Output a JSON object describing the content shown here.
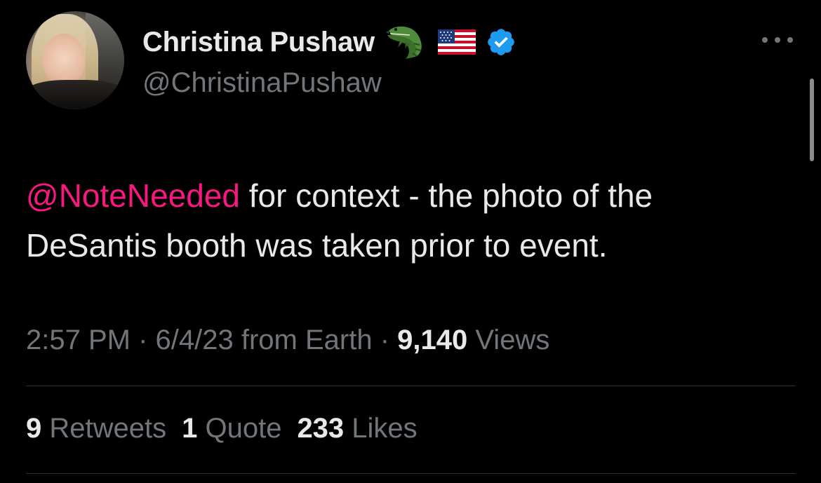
{
  "author": {
    "display_name": "Christina Pushaw",
    "handle": "@ChristinaPushaw",
    "name_badges": [
      "alligator-emoji",
      "us-flag-emoji",
      "verified-badge"
    ]
  },
  "tweet": {
    "mention": "@NoteNeeded",
    "line1_rest": " for context - the photo of the",
    "line2": "DeSantis booth was taken prior to event."
  },
  "meta": {
    "time": "2:57 PM",
    "sep1": " · ",
    "date": "6/4/23",
    "source": " from Earth",
    "sep2": " · ",
    "views_count": "9,140",
    "views_label": " Views"
  },
  "stats": {
    "retweets_count": "9",
    "retweets_label": " Retweets",
    "quotes_count": "1",
    "quotes_label": " Quote",
    "likes_count": "233",
    "likes_label": " Likes"
  },
  "colors": {
    "background": "#000000",
    "text_primary": "#e7e9ea",
    "text_secondary": "#71767b",
    "mention": "#f91880",
    "verified": "#1d9bf0",
    "divider": "#2f3336"
  }
}
